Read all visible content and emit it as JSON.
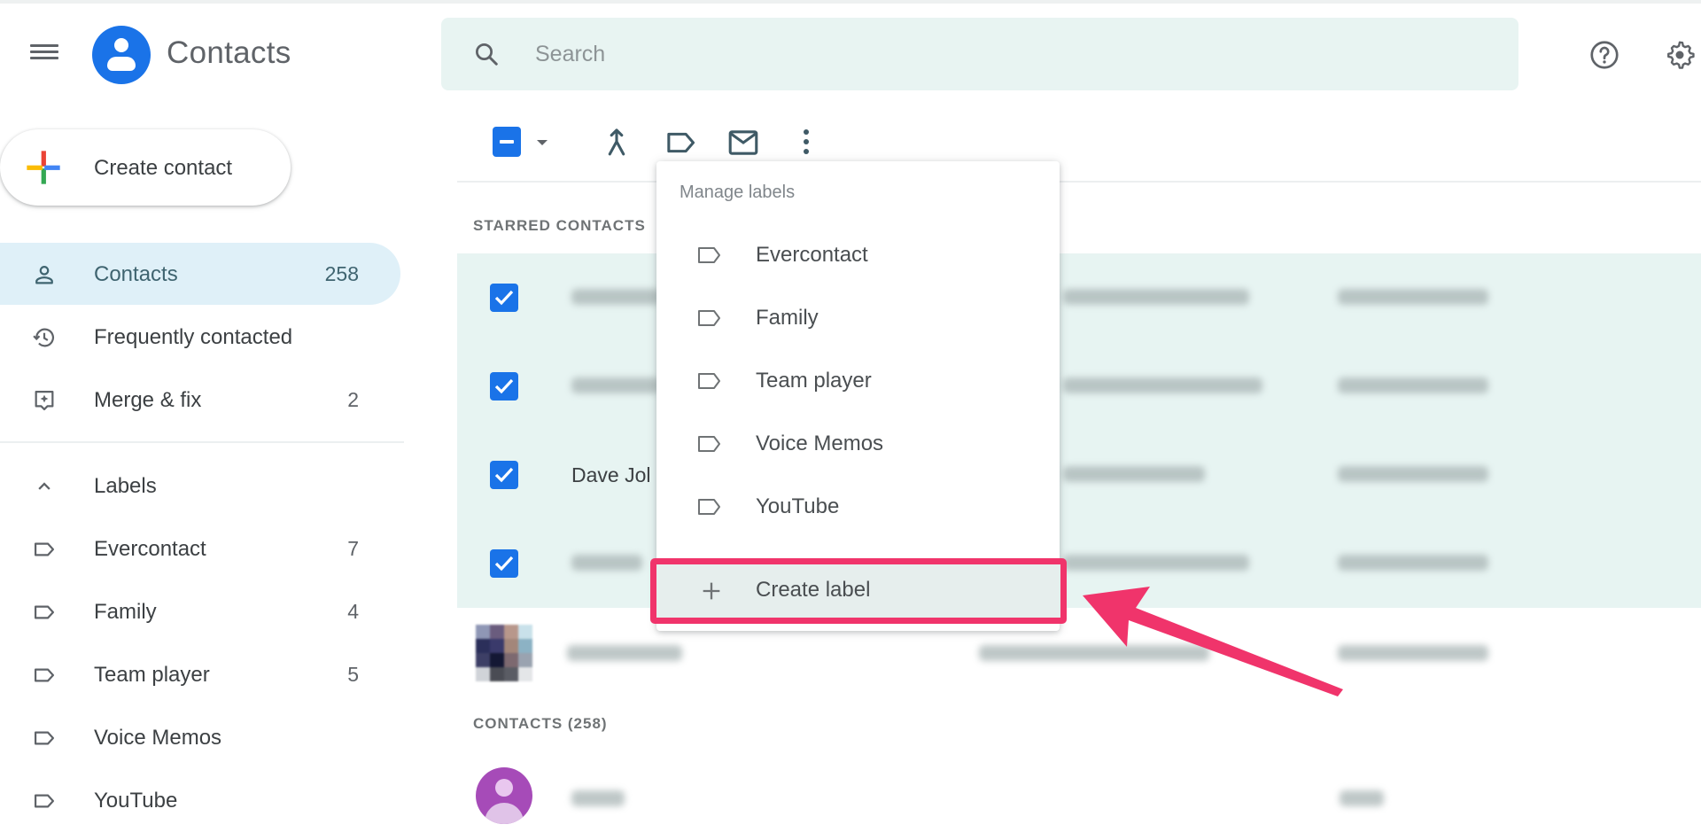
{
  "app": {
    "title": "Contacts"
  },
  "search": {
    "placeholder": "Search"
  },
  "sidebar": {
    "create_label": "Create contact",
    "nav": [
      {
        "label": "Contacts",
        "count": "258",
        "icon": "person-icon",
        "active": true
      },
      {
        "label": "Frequently contacted",
        "count": "",
        "icon": "history-icon"
      },
      {
        "label": "Merge & fix",
        "count": "2",
        "icon": "merge-fix-icon"
      }
    ],
    "labels_header": "Labels",
    "labels": [
      {
        "label": "Evercontact",
        "count": "7"
      },
      {
        "label": "Family",
        "count": "4"
      },
      {
        "label": "Team player",
        "count": "5"
      },
      {
        "label": "Voice Memos",
        "count": ""
      },
      {
        "label": "YouTube",
        "count": ""
      }
    ]
  },
  "toolbar": {
    "icons": [
      "select-all-checkbox",
      "select-dropdown-icon",
      "merge-icon",
      "label-icon",
      "email-icon",
      "more-vert-icon"
    ]
  },
  "content": {
    "starred_header": "STARRED CONTACTS",
    "contacts_header": "CONTACTS (258)",
    "visible_name": "Dave Jol"
  },
  "menu": {
    "title": "Manage labels",
    "items": [
      "Evercontact",
      "Family",
      "Team player",
      "Voice Memos",
      "YouTube"
    ],
    "create_label": "Create label"
  },
  "colors": {
    "accent": "#1a73e8",
    "highlight": "#f0346b",
    "selected_row": "#e7f4f2",
    "active_nav": "#dff0f8"
  }
}
